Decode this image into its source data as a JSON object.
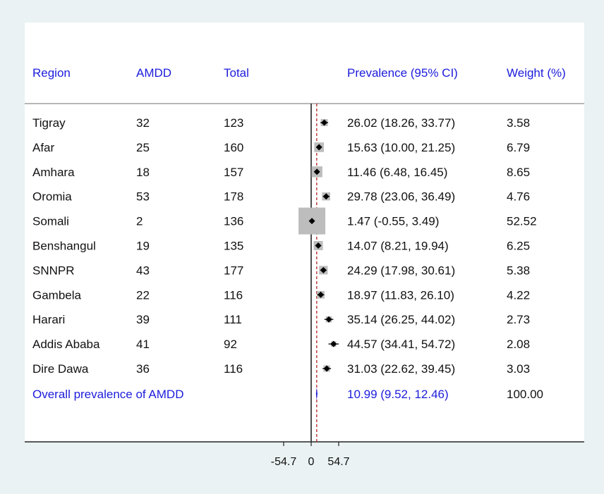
{
  "chart_data": {
    "type": "forest",
    "columns": {
      "region": "Region",
      "events": "AMDD",
      "total": "Total",
      "estimate": "Prevalence (95% CI)",
      "weight": "Weight (%)"
    },
    "rows": [
      {
        "region": "Tigray",
        "amdd": "32",
        "total": "123",
        "est": 26.02,
        "lo": 18.26,
        "hi": 33.77,
        "ci_text": "26.02 (18.26, 33.77)",
        "weight": 3.58,
        "weight_text": "3.58"
      },
      {
        "region": "Afar",
        "amdd": "25",
        "total": "160",
        "est": 15.63,
        "lo": 10.0,
        "hi": 21.25,
        "ci_text": "15.63 (10.00, 21.25)",
        "weight": 6.79,
        "weight_text": "6.79"
      },
      {
        "region": "Amhara",
        "amdd": "18",
        "total": "157",
        "est": 11.46,
        "lo": 6.48,
        "hi": 16.45,
        "ci_text": "11.46 (6.48, 16.45)",
        "weight": 8.65,
        "weight_text": "8.65"
      },
      {
        "region": "Oromia",
        "amdd": "53",
        "total": "178",
        "est": 29.78,
        "lo": 23.06,
        "hi": 36.49,
        "ci_text": "29.78 (23.06, 36.49)",
        "weight": 4.76,
        "weight_text": "4.76"
      },
      {
        "region": "Somali",
        "amdd": "2",
        "total": "136",
        "est": 1.47,
        "lo": -0.55,
        "hi": 3.49,
        "ci_text": "1.47 (-0.55, 3.49)",
        "weight": 52.52,
        "weight_text": "52.52"
      },
      {
        "region": "Benshangul",
        "amdd": "19",
        "total": "135",
        "est": 14.07,
        "lo": 8.21,
        "hi": 19.94,
        "ci_text": "14.07 (8.21, 19.94)",
        "weight": 6.25,
        "weight_text": "6.25"
      },
      {
        "region": "SNNPR",
        "amdd": "43",
        "total": "177",
        "est": 24.29,
        "lo": 17.98,
        "hi": 30.61,
        "ci_text": "24.29 (17.98, 30.61)",
        "weight": 5.38,
        "weight_text": "5.38"
      },
      {
        "region": "Gambela",
        "amdd": "22",
        "total": "116",
        "est": 18.97,
        "lo": 11.83,
        "hi": 26.1,
        "ci_text": "18.97 (11.83, 26.10)",
        "weight": 4.22,
        "weight_text": "4.22"
      },
      {
        "region": "Harari",
        "amdd": "39",
        "total": "111",
        "est": 35.14,
        "lo": 26.25,
        "hi": 44.02,
        "ci_text": "35.14 (26.25, 44.02)",
        "weight": 2.73,
        "weight_text": "2.73"
      },
      {
        "region": "Addis Ababa",
        "amdd": "41",
        "total": "92",
        "est": 44.57,
        "lo": 34.41,
        "hi": 54.72,
        "ci_text": "44.57 (34.41, 54.72)",
        "weight": 2.08,
        "weight_text": "2.08"
      },
      {
        "region": "Dire Dawa",
        "amdd": "36",
        "total": "116",
        "est": 31.03,
        "lo": 22.62,
        "hi": 39.45,
        "ci_text": "31.03 (22.62, 39.45)",
        "weight": 3.03,
        "weight_text": "3.03"
      }
    ],
    "overall": {
      "label": "Overall prevalence of AMDD",
      "est": 10.99,
      "lo": 9.52,
      "hi": 12.46,
      "ci_text": "10.99 (9.52, 12.46)",
      "weight_text": "100.00"
    },
    "x_axis": {
      "ticks": [
        -54.7,
        0,
        54.7
      ],
      "tick_labels": [
        "-54.7",
        "0",
        "54.7"
      ],
      "xlim": [
        -54.7,
        54.7
      ]
    },
    "null_line": 0,
    "pooled_line": 10.99,
    "colors": {
      "header_text": "#1c1cdc",
      "overall_text": "#1c1cdc",
      "weight_box": "#bdbdbd",
      "point": "#000000",
      "pooled_line": "#b22222",
      "overall_diamond": "#1c1cdc"
    }
  }
}
